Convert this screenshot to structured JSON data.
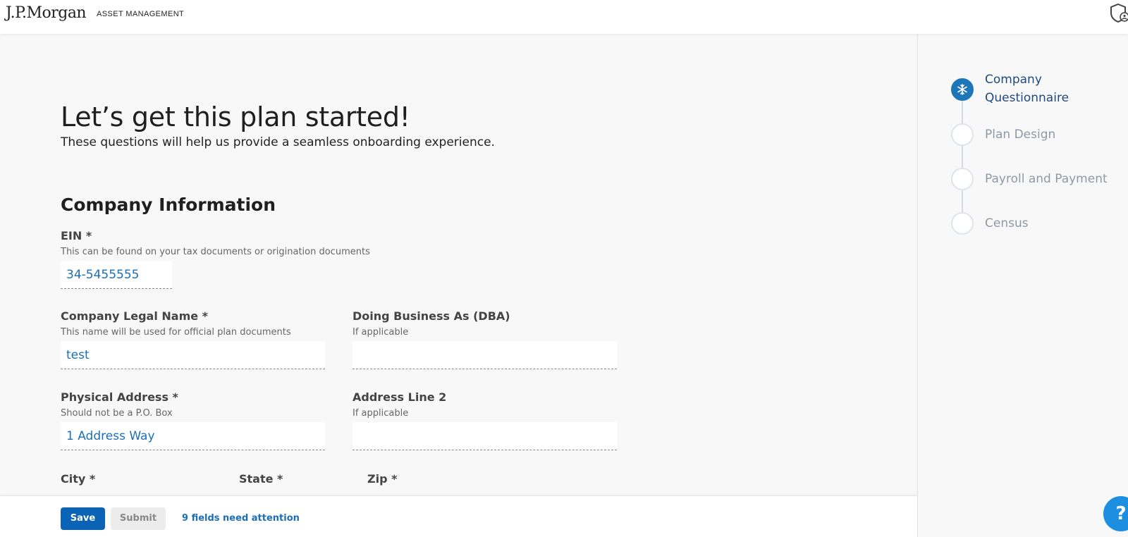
{
  "header": {
    "brand": "J.P.Morgan",
    "brand_sub": "ASSET MANAGEMENT"
  },
  "hero": {
    "title": "Let’s get this plan started!",
    "subtitle": "These questions will help us provide a seamless onboarding experience."
  },
  "section": {
    "title": "Company Information"
  },
  "fields": {
    "ein": {
      "label": "EIN *",
      "help": "This can be found on your tax documents or origination documents",
      "value": "34-5455555"
    },
    "legal_name": {
      "label": "Company Legal Name *",
      "help": "This name will be used for official plan documents",
      "value": "test"
    },
    "dba": {
      "label": "Doing Business As (DBA)",
      "help": "If applicable",
      "value": ""
    },
    "address": {
      "label": "Physical Address *",
      "help": "Should not be a P.O. Box",
      "value": "1 Address Way"
    },
    "address2": {
      "label": "Address Line 2",
      "help": "If applicable",
      "value": ""
    },
    "city": {
      "label": "City *"
    },
    "state": {
      "label": "State *"
    },
    "zip": {
      "label": "Zip *"
    }
  },
  "footer": {
    "save_label": "Save",
    "submit_label": "Submit",
    "attention_text": "9 fields need attention"
  },
  "steps": [
    {
      "label_line1": "Company",
      "label_line2": "Questionnaire",
      "active": true
    },
    {
      "label": "Plan Design",
      "active": false
    },
    {
      "label": "Payroll and Payment",
      "active": false
    },
    {
      "label": "Census",
      "active": false
    }
  ],
  "help_button": {
    "label": "?"
  },
  "colors": {
    "primary": "#0b63b6",
    "link": "#1a6fb8",
    "step_active": "#1d76b8"
  }
}
